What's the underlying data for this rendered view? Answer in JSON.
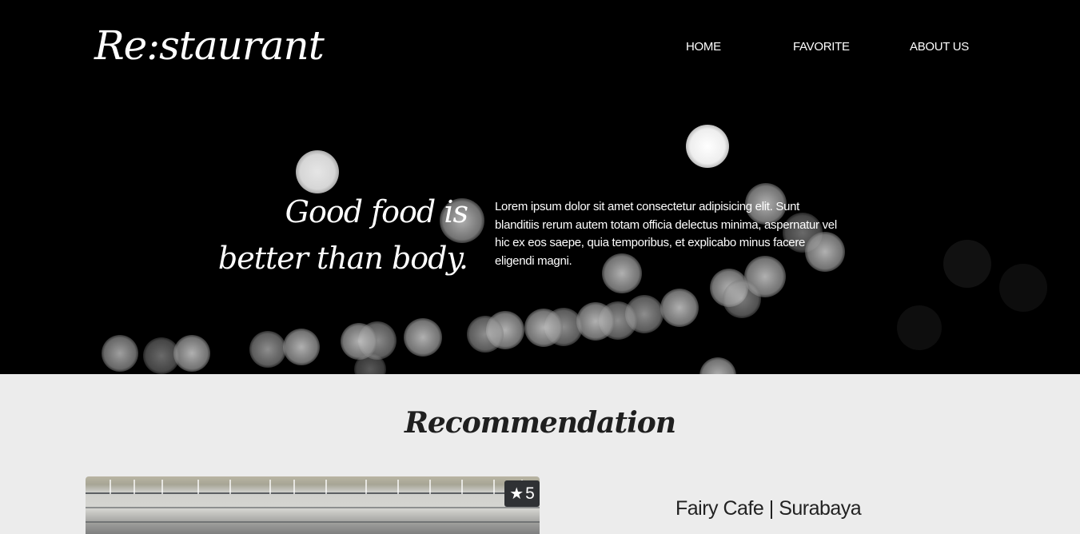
{
  "header": {
    "brand": "Re:staurant",
    "nav": [
      "HOME",
      "FAVORITE",
      "ABOUT US"
    ]
  },
  "hero": {
    "tagline_line1": "Good food is",
    "tagline_line2": "better than body.",
    "description": "Lorem ipsum dolor sit amet consectetur adipisicing elit. Sunt blanditiis rerum autem totam officia delectus minima, aspernatur vel hic ex eos saepe, quia temporibus, et explicabo minus facere eligendi magni."
  },
  "recommendation": {
    "title": "Recommendation",
    "card": {
      "rating": "5",
      "name": "Fairy Cafe | Surabaya"
    }
  },
  "icons": {
    "rating": "star-icon"
  },
  "colors": {
    "hero_bg": "#000000",
    "page_bg": "#ececec",
    "badge_bg": "#2f3134"
  }
}
